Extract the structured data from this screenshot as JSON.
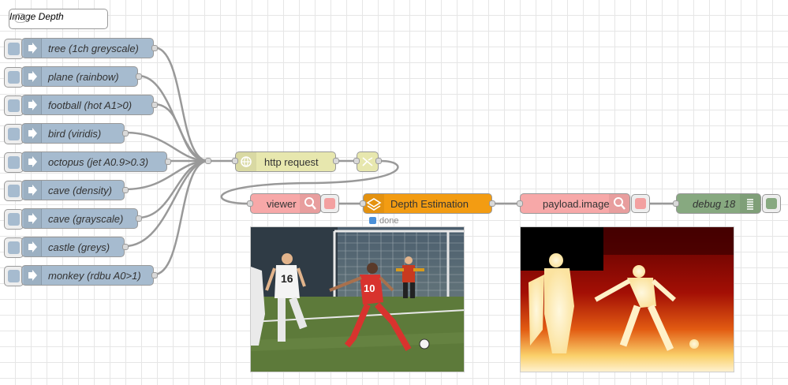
{
  "comment": {
    "label": "Image Depth"
  },
  "inject_nodes": [
    {
      "label": "tree (1ch greyscale)"
    },
    {
      "label": "plane (rainbow)"
    },
    {
      "label": "football (hot A1>0)"
    },
    {
      "label": "bird (viridis)"
    },
    {
      "label": "octopus (jet A0.9>0.3)"
    },
    {
      "label": "cave (density)"
    },
    {
      "label": "cave (grayscale)"
    },
    {
      "label": "castle (greys)"
    },
    {
      "label": "monkey (rdbu A0>1)"
    }
  ],
  "http_request": {
    "label": "http request"
  },
  "viewer": {
    "label": "viewer"
  },
  "depth_estimation": {
    "label": "Depth Estimation",
    "status": "done"
  },
  "payload_image": {
    "label": "payload.image"
  },
  "debug": {
    "label": "debug 18"
  },
  "images": {
    "photo": {
      "jersey_front": "10",
      "jersey_back": "16"
    }
  },
  "colors": {
    "inject": "#a6bbcf",
    "http": "#e7e7ae",
    "viewer": "#f7a8a8",
    "depth": "#f39c12",
    "debug": "#87a980",
    "status_done": "#4a90d9"
  }
}
